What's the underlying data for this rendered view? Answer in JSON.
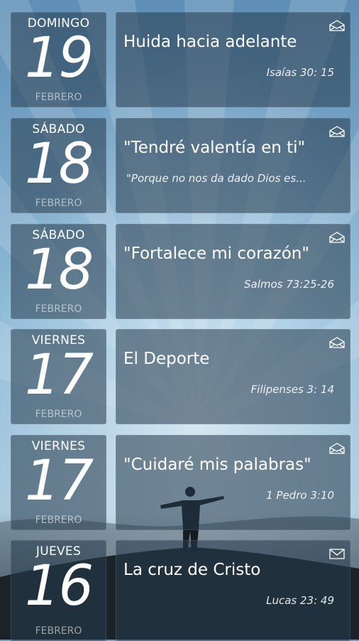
{
  "entries": [
    {
      "weekday": "DOMINGO",
      "day": "19",
      "month": "FEBRERO",
      "title": "Huida hacia adelante",
      "reference": "Isaías 30: 15",
      "mail_icon": "open-envelope-icon"
    },
    {
      "weekday": "SÁBADO",
      "day": "18",
      "month": "FEBRERO",
      "title": "\"Tendré valentía en ti\"",
      "reference": "\"Porque no nos da dado Dios es...",
      "mail_icon": "open-envelope-icon"
    },
    {
      "weekday": "SÁBADO",
      "day": "18",
      "month": "FEBRERO",
      "title": "\"Fortalece mi corazón\"",
      "reference": "Salmos 73:25-26",
      "mail_icon": "open-envelope-icon"
    },
    {
      "weekday": "VIERNES",
      "day": "17",
      "month": "FEBRERO",
      "title": "El Deporte",
      "reference": "Filipenses 3: 14",
      "mail_icon": "open-envelope-icon"
    },
    {
      "weekday": "VIERNES",
      "day": "17",
      "month": "FEBRERO",
      "title": "\"Cuidaré mis palabras\"",
      "reference": "1 Pedro 3:10",
      "mail_icon": "open-envelope-icon"
    },
    {
      "weekday": "JUEVES",
      "day": "16",
      "month": "FEBRERO",
      "title": "La cruz de Cristo",
      "reference": "Lucas 23: 49",
      "mail_icon": "closed-envelope-icon"
    }
  ]
}
